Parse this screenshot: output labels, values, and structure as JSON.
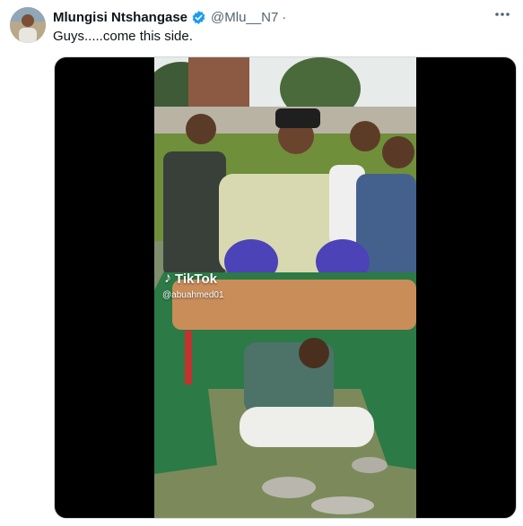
{
  "tweet": {
    "author_name": "Mlungisi Ntshangase",
    "handle": "@Mlu__N7",
    "separator": "·",
    "text": "Guys.....come this side.",
    "verified": true,
    "more_icon": "more-horizontal-icon"
  },
  "media": {
    "watermark_brand": "TikTok",
    "watermark_handle": "@abuahmed01"
  },
  "colors": {
    "verified_blue": "#1d9bf0",
    "text_primary": "#0f1419",
    "text_secondary": "#536471",
    "media_border": "#cfd9de"
  }
}
